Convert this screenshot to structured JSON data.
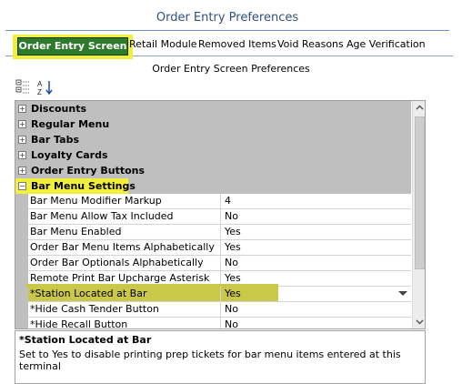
{
  "window": {
    "title": "Order Entry Preferences"
  },
  "tabs": [
    {
      "label": "Order Entry Screen",
      "active": true
    },
    {
      "label": "Retail Module"
    },
    {
      "label": "Removed Items"
    },
    {
      "label": "Void Reasons"
    },
    {
      "label": "Age Verification"
    }
  ],
  "panel": {
    "title": "Order Entry Screen Preferences"
  },
  "toolbar": {
    "categorized_icon": "categorized-icon",
    "alphabetical_icon": "sort-az-icon"
  },
  "categories": [
    {
      "label": "Discounts",
      "expanded": false
    },
    {
      "label": "Regular Menu",
      "expanded": false
    },
    {
      "label": "Bar Tabs",
      "expanded": false
    },
    {
      "label": "Loyalty Cards",
      "expanded": false
    },
    {
      "label": "Order Entry Buttons",
      "expanded": false
    },
    {
      "label": "Bar Menu Settings",
      "expanded": true
    }
  ],
  "properties": [
    {
      "name": "Bar Menu Modifier Markup",
      "value": "4"
    },
    {
      "name": "Bar Menu Allow Tax Included",
      "value": "No"
    },
    {
      "name": "Bar Menu Enabled",
      "value": "Yes"
    },
    {
      "name": "Order Bar Menu Items Alphabetically",
      "value": "Yes"
    },
    {
      "name": "Order Bar Optionals Alphabetically",
      "value": "No"
    },
    {
      "name": "Remote Print Bar Upcharge Asterisk",
      "value": "Yes"
    },
    {
      "name": "*Station Located at Bar",
      "value": "Yes",
      "selected": true
    },
    {
      "name": "*Hide Cash Tender Button",
      "value": "No"
    },
    {
      "name": "*Hide Recall Button",
      "value": "No"
    }
  ],
  "description": {
    "title": "*Station Located at Bar",
    "text": "Set to Yes to disable printing prep tickets for bar menu items entered at this terminal"
  },
  "colors": {
    "highlight": "#f2ef3a",
    "active_tab": "#2d7a2d",
    "category_bg": "#bfbfbf"
  }
}
